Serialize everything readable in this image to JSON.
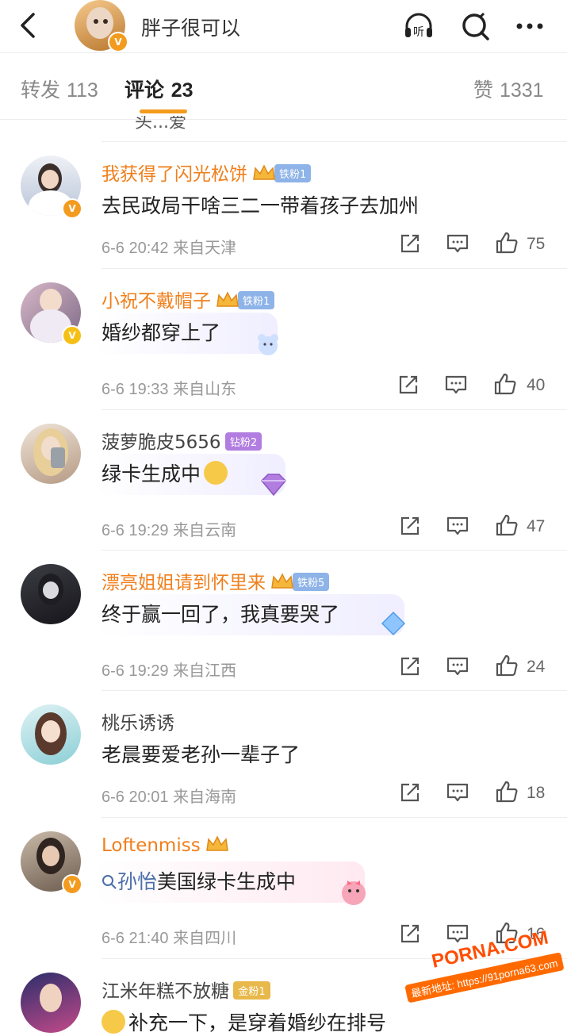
{
  "header": {
    "username": "胖子很可以",
    "listen_label": "听"
  },
  "tabs": [
    {
      "label": "转发",
      "count": "113"
    },
    {
      "label": "评论",
      "count": "23"
    },
    {
      "label": "赞",
      "count": "1331"
    }
  ],
  "partial_previous_text": "头...爱",
  "comments": [
    {
      "name": "我获得了闪光松饼",
      "fan": "铁粉1",
      "text": "去民政局干啥三二一带着孩子去加州",
      "date": "6-6 20:42",
      "location": "来自天津",
      "likes": "75"
    },
    {
      "name": "小祝不戴帽子",
      "fan": "铁粉1",
      "text": "婚纱都穿上了",
      "date": "6-6 19:33",
      "location": "来自山东",
      "likes": "40"
    },
    {
      "name": "菠萝脆皮5656",
      "fan": "钻粉2",
      "text": "绿卡生成中",
      "date": "6-6 19:29",
      "location": "来自云南",
      "likes": "47"
    },
    {
      "name": "漂亮姐姐请到怀里来",
      "fan": "铁粉5",
      "text": "终于赢一回了，我真要哭了",
      "date": "6-6 19:29",
      "location": "来自江西",
      "likes": "24"
    },
    {
      "name": "桃乐诱诱",
      "fan": "",
      "text": "老晨要爱老孙一辈子了",
      "date": "6-6 20:01",
      "location": "来自海南",
      "likes": "18"
    },
    {
      "name": "Loftenmiss",
      "fan": "",
      "topic": "孙怡",
      "text": "美国绿卡生成中",
      "date": "6-6 21:40",
      "location": "来自四川",
      "likes": "16"
    },
    {
      "name": "江米年糕不放糖",
      "fan": "金粉1",
      "text": "补充一下，是穿着婚纱在排号",
      "date": "",
      "location": "",
      "likes": ""
    }
  ],
  "watermark": {
    "main": "PORNA.COM",
    "sub": "最新地址: https://91porna63.com"
  },
  "colors": {
    "accent": "#f39b1e",
    "vip_name": "#f07f1c",
    "topic": "#4a6ea9"
  }
}
